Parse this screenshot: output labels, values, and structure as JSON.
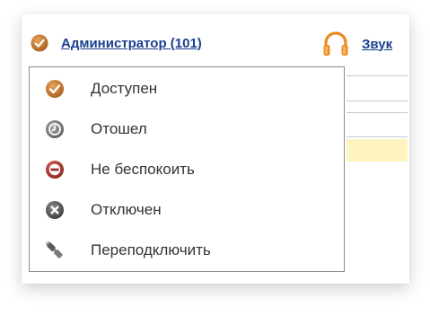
{
  "header": {
    "user_label": "Администратор (101)",
    "sound_label": "Звук"
  },
  "status_menu": {
    "items": [
      {
        "label": "Доступен",
        "icon": "available-check-icon"
      },
      {
        "label": "Отошел",
        "icon": "away-clock-icon"
      },
      {
        "label": "Не беспокоить",
        "icon": "do-not-disturb-icon"
      },
      {
        "label": "Отключен",
        "icon": "offline-x-icon"
      },
      {
        "label": "Переподключить",
        "icon": "reconnect-plug-icon"
      }
    ]
  },
  "colors": {
    "link": "#1a3f8f",
    "available": "#c47a2c",
    "away": "#7b7b7b",
    "dnd": "#b0342a",
    "offline": "#555555",
    "headphones": "#f08a1e",
    "highlight_row": "#fdf4bf"
  }
}
